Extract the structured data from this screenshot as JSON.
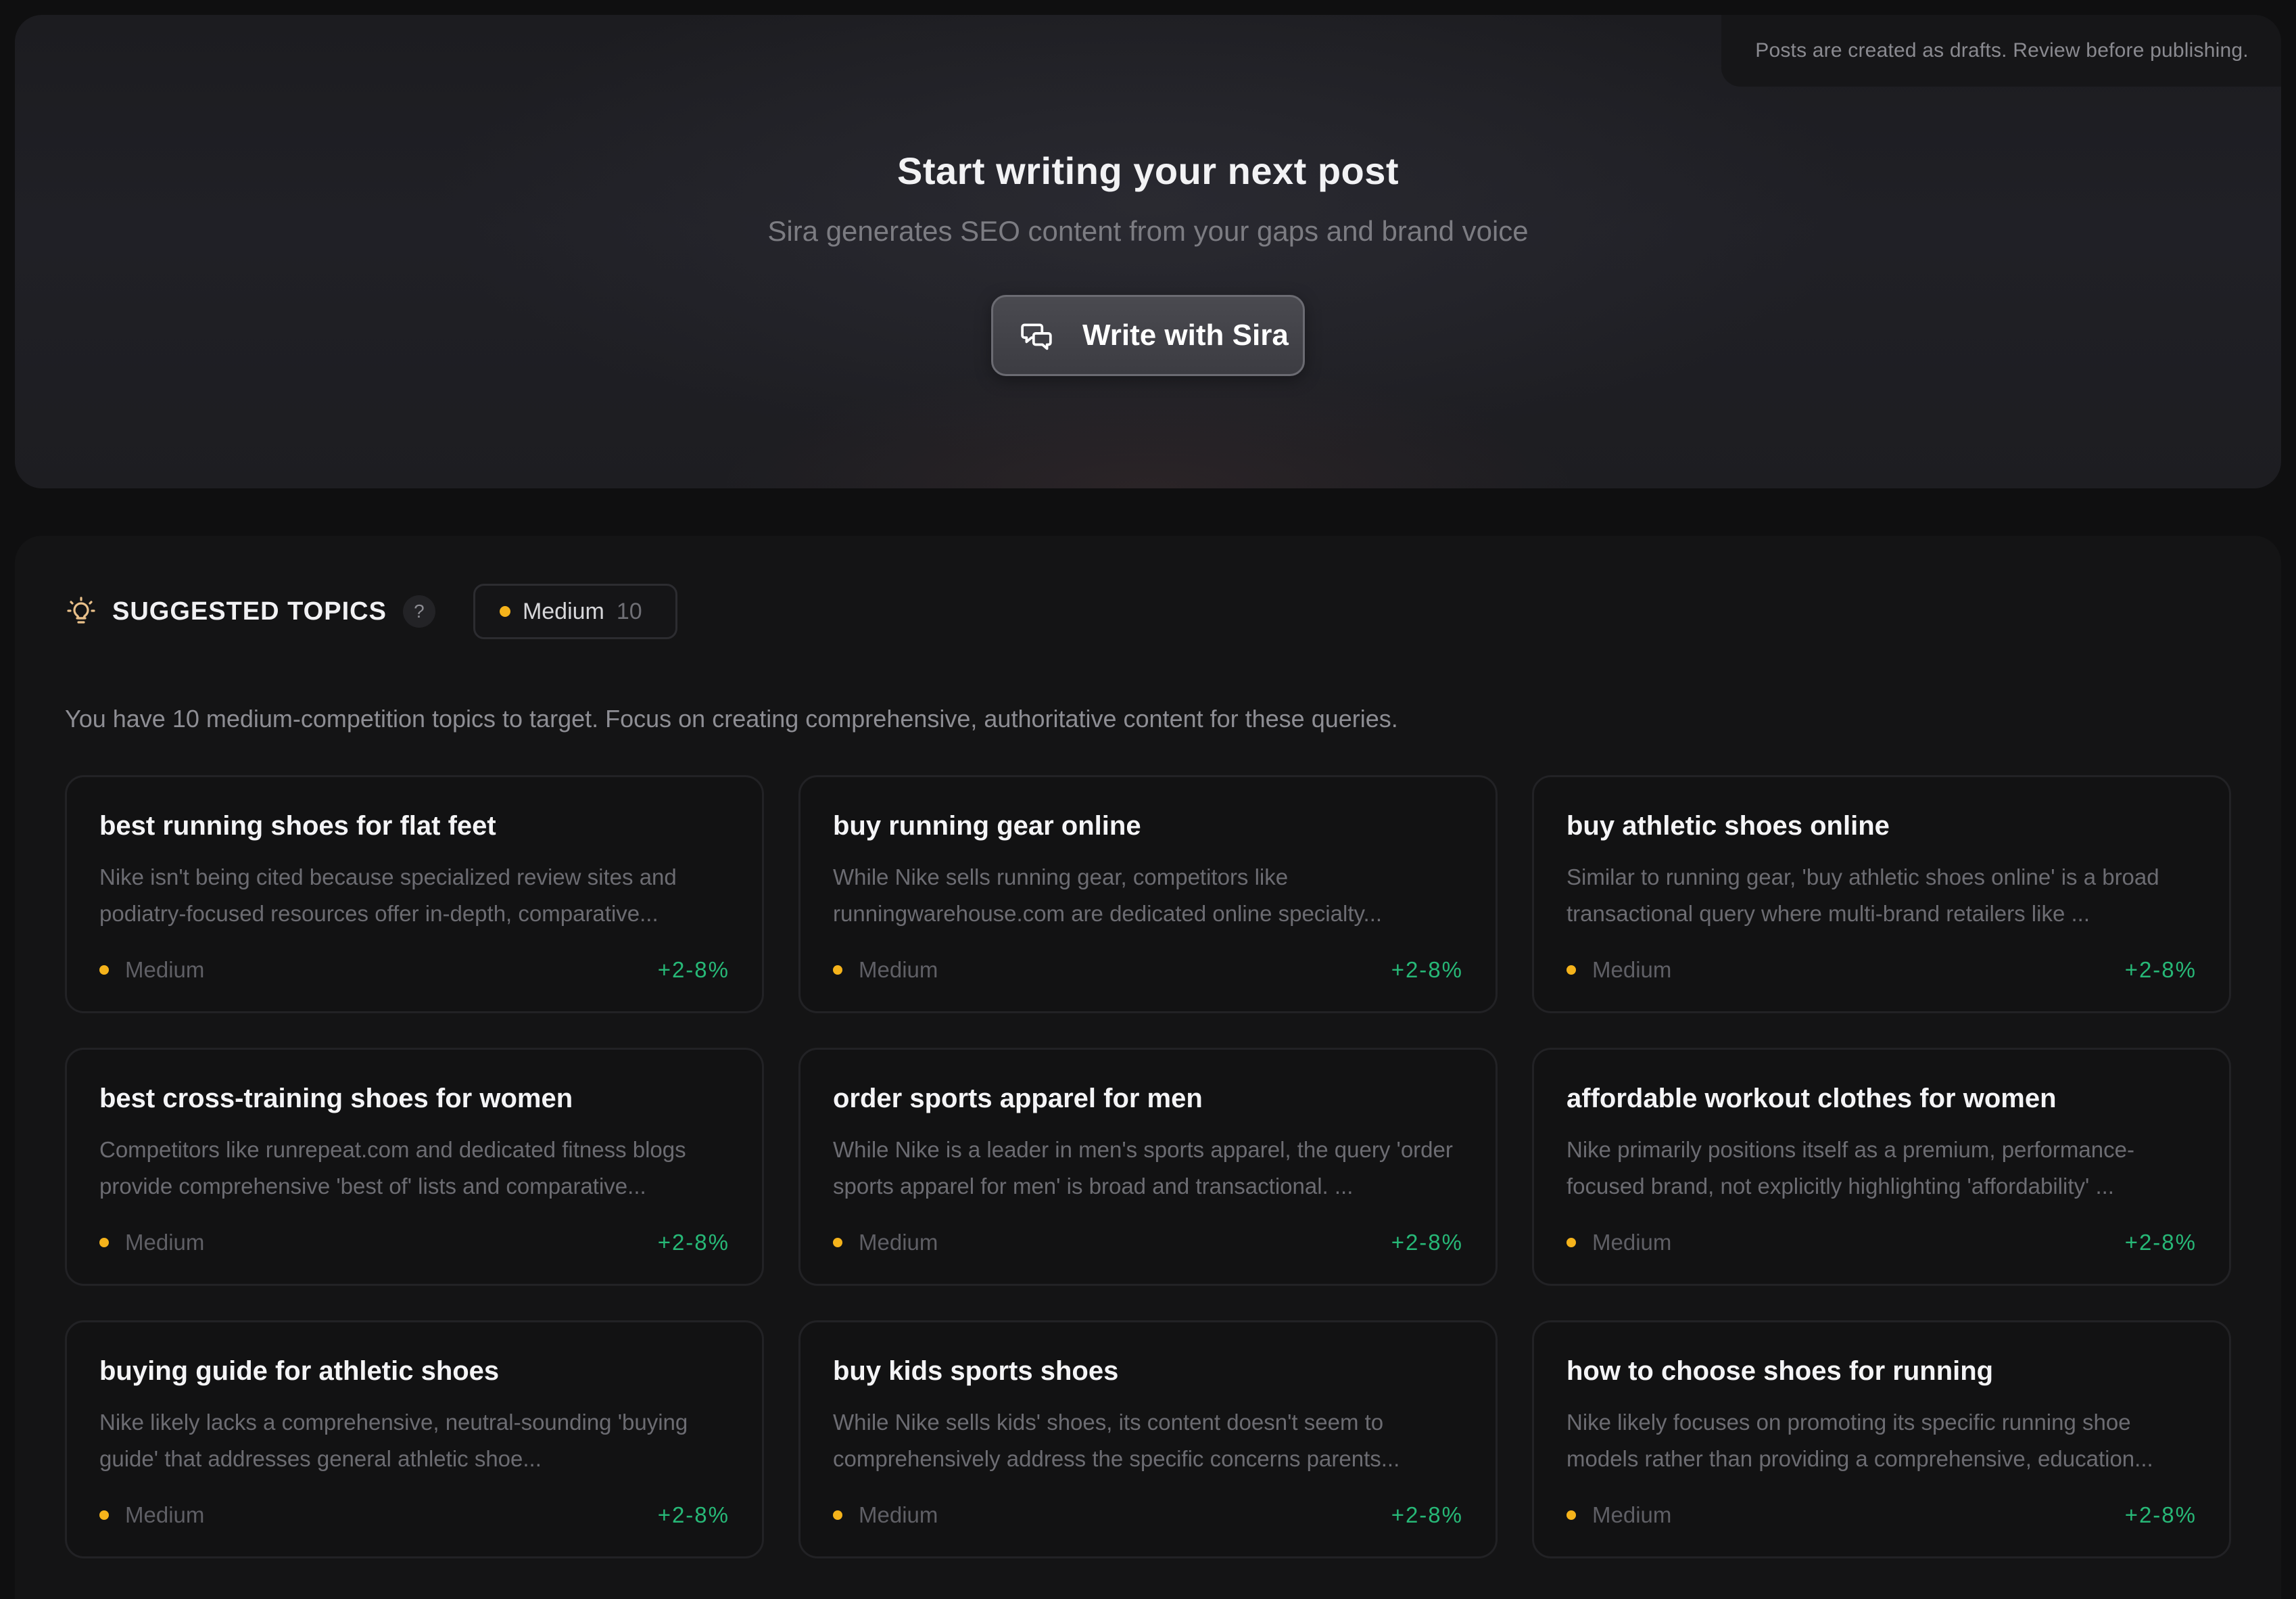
{
  "hero": {
    "notice": "Posts are created as drafts. Review before publishing.",
    "title": "Start writing your next post",
    "subtitle": "Sira generates SEO content from your gaps and brand voice",
    "write_button": "Write with Sira",
    "write_icon": "chat-bubbles-icon"
  },
  "topics": {
    "title": "SUGGESTED TOPICS",
    "title_icon": "lightbulb-icon",
    "help": "?",
    "filter": {
      "label": "Medium",
      "count": "10",
      "dot_color": "#f5b31b"
    },
    "description": "You have 10 medium-competition topics to target. Focus on creating comprehensive, authoritative content for these queries.",
    "cards": [
      {
        "title": "best running shoes for flat feet",
        "desc": "Nike isn't being cited because specialized review sites and podiatry-focused resources offer in-depth, comparative...",
        "level": "Medium",
        "impact": "+2-8%"
      },
      {
        "title": "buy running gear online",
        "desc": "While Nike sells running gear, competitors like runningwarehouse.com are dedicated online specialty...",
        "level": "Medium",
        "impact": "+2-8%"
      },
      {
        "title": "buy athletic shoes online",
        "desc": "Similar to running gear, 'buy athletic shoes online' is a broad transactional query where multi-brand retailers like ...",
        "level": "Medium",
        "impact": "+2-8%"
      },
      {
        "title": "best cross-training shoes for women",
        "desc": "Competitors like runrepeat.com and dedicated fitness blogs provide comprehensive 'best of' lists and comparative...",
        "level": "Medium",
        "impact": "+2-8%"
      },
      {
        "title": "order sports apparel for men",
        "desc": "While Nike is a leader in men's sports apparel, the query 'order sports apparel for men' is broad and transactional. ...",
        "level": "Medium",
        "impact": "+2-8%"
      },
      {
        "title": "affordable workout clothes for women",
        "desc": "Nike primarily positions itself as a premium, performance-focused brand, not explicitly highlighting 'affordability' ...",
        "level": "Medium",
        "impact": "+2-8%"
      },
      {
        "title": "buying guide for athletic shoes",
        "desc": "Nike likely lacks a comprehensive, neutral-sounding 'buying guide' that addresses general athletic shoe...",
        "level": "Medium",
        "impact": "+2-8%"
      },
      {
        "title": "buy kids sports shoes",
        "desc": "While Nike sells kids' shoes, its content doesn't seem to comprehensively address the specific concerns parents...",
        "level": "Medium",
        "impact": "+2-8%"
      },
      {
        "title": "how to choose shoes for running",
        "desc": "Nike likely focuses on promoting its specific running shoe models rather than providing a comprehensive, education...",
        "level": "Medium",
        "impact": "+2-8%"
      }
    ]
  },
  "colors": {
    "background": "#0f0f10",
    "medium_dot": "#f5b31b",
    "impact_green": "#27b877"
  }
}
